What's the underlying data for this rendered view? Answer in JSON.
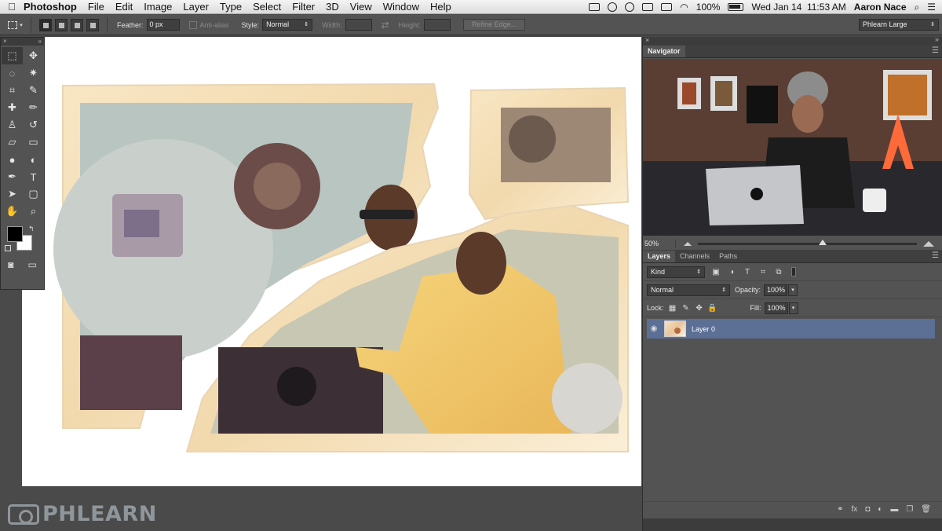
{
  "menubar": {
    "app_name": "Photoshop",
    "menus": [
      "File",
      "Edit",
      "Image",
      "Layer",
      "Type",
      "Select",
      "Filter",
      "3D",
      "View",
      "Window",
      "Help"
    ],
    "battery": "100%",
    "datetime": "Wed Jan 14  11:53 AM",
    "user": "Aaron Nace"
  },
  "options": {
    "feather_label": "Feather:",
    "feather_value": "0 px",
    "antialias_label": "Anti-alias",
    "style_label": "Style:",
    "style_value": "Normal",
    "width_label": "Width:",
    "height_label": "Height:",
    "refine_edge_label": "Refine Edge...",
    "workspace": "Phlearn Large"
  },
  "tools": {
    "foreground_color": "#000000",
    "background_color": "#ffffff"
  },
  "navigator": {
    "title": "Navigator",
    "zoom": "50%",
    "zoom_fraction": 0.57
  },
  "layers": {
    "tabs": [
      "Layers",
      "Channels",
      "Paths"
    ],
    "filter_kind": "Kind",
    "blend_mode": "Normal",
    "opacity_label": "Opacity:",
    "opacity_value": "100%",
    "lock_label": "Lock:",
    "fill_label": "Fill:",
    "fill_value": "100%",
    "items": [
      {
        "name": "Layer 0",
        "visible": true,
        "selected": true
      }
    ]
  },
  "watermark": "PHLEARN",
  "colors": {
    "selected_layer": "#5c6f94",
    "panel": "#535353"
  }
}
